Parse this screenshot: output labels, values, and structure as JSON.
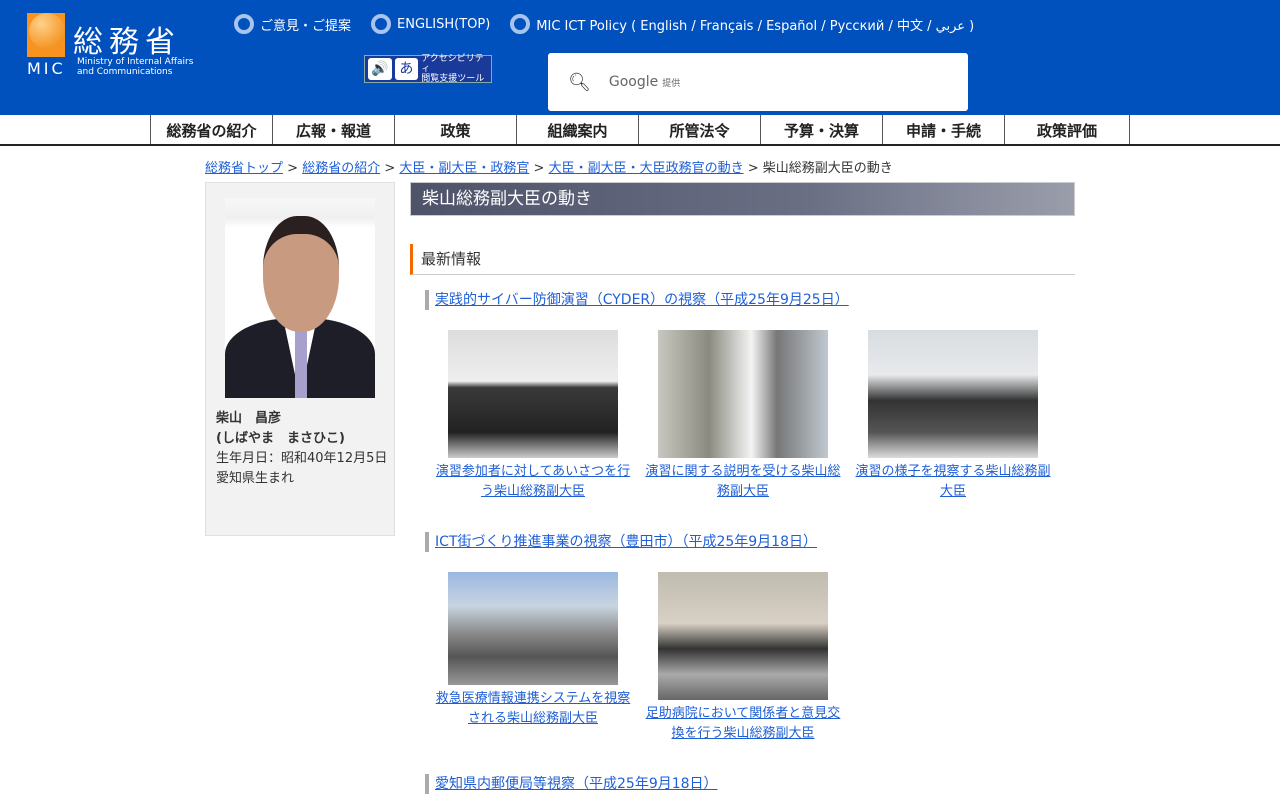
{
  "header": {
    "logo_kanji": "総務省",
    "logo_mic": "MIC",
    "logo_en_1": "Ministry of Internal Affairs",
    "logo_en_2": "and Communications",
    "links": [
      "ご意見・ご提案",
      "ENGLISH(TOP)",
      "MIC ICT Policy ( English / Français / Español / Русский / 中文 / عربي )"
    ],
    "access_label_1": "アクセシビリティ",
    "access_label_2": "閲覧支援ツール",
    "access_icon": "あ",
    "search_brand": "Google",
    "search_suffix": "提供"
  },
  "nav": [
    "総務省の紹介",
    "広報・報道",
    "政策",
    "組織案内",
    "所管法令",
    "予算・決算",
    "申請・手続",
    "政策評価"
  ],
  "breadcrumb": {
    "links": [
      "総務省トップ",
      "総務省の紹介",
      "大臣・副大臣・政務官",
      "大臣・副大臣・大臣政務官の動き"
    ],
    "sep": " > ",
    "current": "柴山総務副大臣の動き"
  },
  "profile": {
    "name": "柴山　昌彦",
    "kana": "(しばやま　まさひこ)",
    "birth": "生年月日：昭和40年12月5日",
    "birthplace": "愛知県生まれ"
  },
  "main": {
    "title": "柴山総務副大臣の動き",
    "section": "最新情報",
    "entries": [
      {
        "title": "実践的サイバー防御演習（CYDER）の視察（平成25年9月25日）",
        "photos": [
          "演習参加者に対してあいさつを行う柴山総務副大臣",
          "演習に関する説明を受ける柴山総務副大臣",
          "演習の様子を視察する柴山総務副大臣"
        ]
      },
      {
        "title": "ICT街づくり推進事業の視察（豊田市）（平成25年9月18日）",
        "photos": [
          "救急医療情報連携システムを視察される柴山総務副大臣",
          "足助病院において関係者と意見交換を行う柴山総務副大臣"
        ]
      },
      {
        "title": "愛知県内郵便局等視察（平成25年9月18日）",
        "photos": []
      }
    ]
  }
}
